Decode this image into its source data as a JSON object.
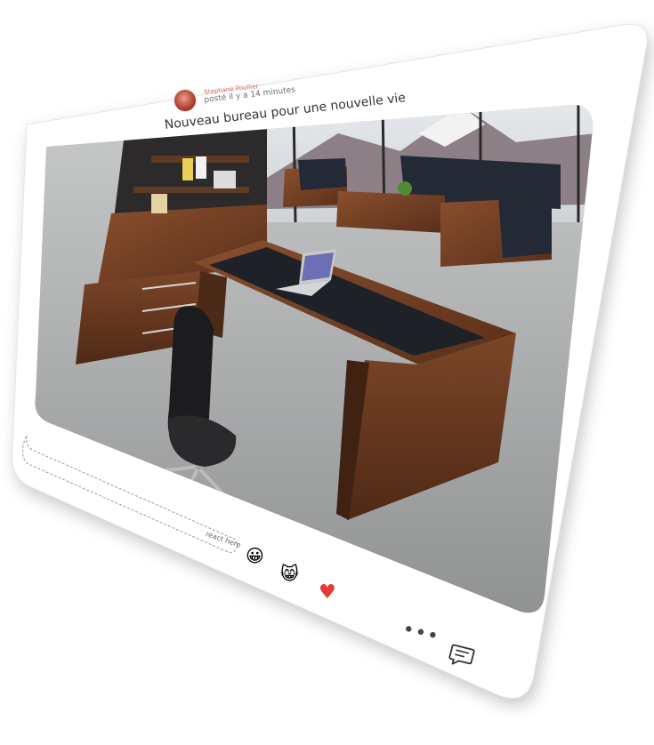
{
  "post": {
    "author": "Stephane Poullier",
    "time": "posté il y a 14 minutes",
    "title": "Nouveau bureau pour une nouvelle vie"
  },
  "reactions": {
    "react_placeholder": "react here",
    "items": [
      {
        "name": "smile",
        "glyph": "😀"
      },
      {
        "name": "cat",
        "glyph": "😸"
      },
      {
        "name": "heart",
        "glyph": "♥"
      }
    ]
  },
  "actions": {
    "more": "•••"
  },
  "colors": {
    "author": "#e06a55",
    "heart": "#e53935",
    "wood": "#6b3a22",
    "leather": "#1e2228"
  },
  "icons": [
    "more-options-icon",
    "comment-icon"
  ]
}
